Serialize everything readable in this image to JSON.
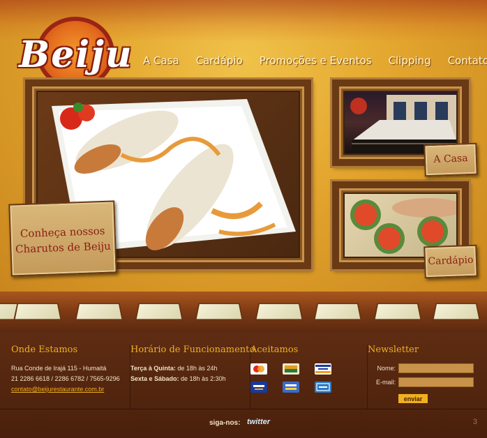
{
  "logo": {
    "text": "Beiju"
  },
  "nav": {
    "items": [
      {
        "label": "A Casa"
      },
      {
        "label": "Cardápio"
      },
      {
        "label": "Promoções e Eventos"
      },
      {
        "label": "Clipping"
      },
      {
        "label": "Contato"
      }
    ]
  },
  "features": {
    "main": {
      "label_line1": "Conheça nossos",
      "label_line2": "Charutos de Beiju"
    },
    "casa": {
      "label": "A Casa"
    },
    "cardapio": {
      "label": "Cardápio"
    }
  },
  "footer": {
    "location": {
      "title": "Onde Estamos",
      "address": "Rua Conde de Irajá 115 - Humaitá",
      "phones": "21 2286 6618 / 2286 6782 / 7565-9296",
      "email": "contato@beijurestaurante.com.br"
    },
    "hours": {
      "title": "Horário de Funcionamento",
      "line1_days": "Terça à Quinta:",
      "line1_time": " de 18h às 24h",
      "line2_days": "Sexta e Sábado:",
      "line2_time": " de 18h às 2:30h"
    },
    "payments": {
      "title": "Aceitamos",
      "cards": [
        "mastercard",
        "redeshop",
        "VISA",
        "VISA Electron",
        "VISA Vale",
        "AMEX"
      ]
    },
    "newsletter": {
      "title": "Newsletter",
      "name_label": "Nome:",
      "email_label": "E-mail:",
      "button_label": "enviar"
    },
    "social": {
      "follow_label": "siga-nos:",
      "twitter_label": "twitter"
    },
    "page_number": "3"
  },
  "colors": {
    "accent": "#f0b020",
    "footer_bg": "#4a200c",
    "board_text": "#8a1e10"
  }
}
